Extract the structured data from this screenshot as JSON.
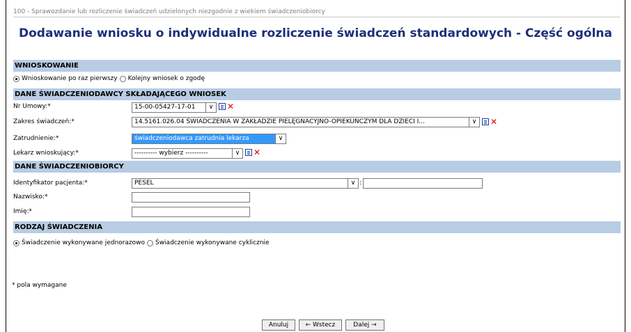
{
  "breadcrumb": "100 - Sprawozdanie lub rozliczenie świadczeń udzielonych niezgodnie z wiekiem świadczeniobiorcy",
  "title": "Dodawanie wniosku o indywidualne rozliczenie świadczeń standardowych - Część ogólna",
  "sections": {
    "wnioskowanie": "WNIOSKOWANIE",
    "dane_swiadczeniodawcy": "DANE ŚWIADCZENIODAWCY SKŁADAJĄCEGO WNIOSEK",
    "dane_swiadczeniobiorcy": "DANE ŚWIADCZENIOBIORCY",
    "rodzaj_swiadczenia": "RODZAJ ŚWIADCZENIA"
  },
  "wnioskowanie": {
    "opt1": "Wnioskowanie po raz pierwszy",
    "opt2": "Kolejny wniosek o zgodę",
    "selected": "opt1"
  },
  "fields": {
    "nr_umowy_label": "Nr Umowy:*",
    "nr_umowy_value": "15-00-05427-17-01",
    "zakres_label": "Zakres świadczeń:*",
    "zakres_value": "14.5161.026.04 ŚWIADCZENIA W ZAKŁADZIE PIELĘGNACYJNO-OPIEKUŃCZYM DLA DZIECI I...",
    "zatrudnienie_label": "Zatrudnienie:*",
    "zatrudnienie_value": "świadczeniodawca zatrudnia lekarza",
    "lekarz_label": "Lekarz wnioskujący:*",
    "lekarz_value": "---------- wybierz ----------",
    "identyfikator_label": "Identyfikator pacjenta:*",
    "identyfikator_value": "PESEL",
    "identyfikator_sep": ":",
    "nazwisko_label": "Nazwisko:*",
    "imie_label": "Imię:*"
  },
  "rodzaj": {
    "opt1": "Świadczenie wykonywane jednorazowo",
    "opt2": "Świadczenie wykonywane cyklicznie",
    "selected": "opt1"
  },
  "footnote": "* pola wymagane",
  "buttons": {
    "anuluj": "Anuluj",
    "wstecz": "← Wstecz",
    "dalej": "Dalej →"
  },
  "icons": {
    "list": "list-icon",
    "delete": "delete-x-icon",
    "dropdown": "chevron-down-icon"
  }
}
